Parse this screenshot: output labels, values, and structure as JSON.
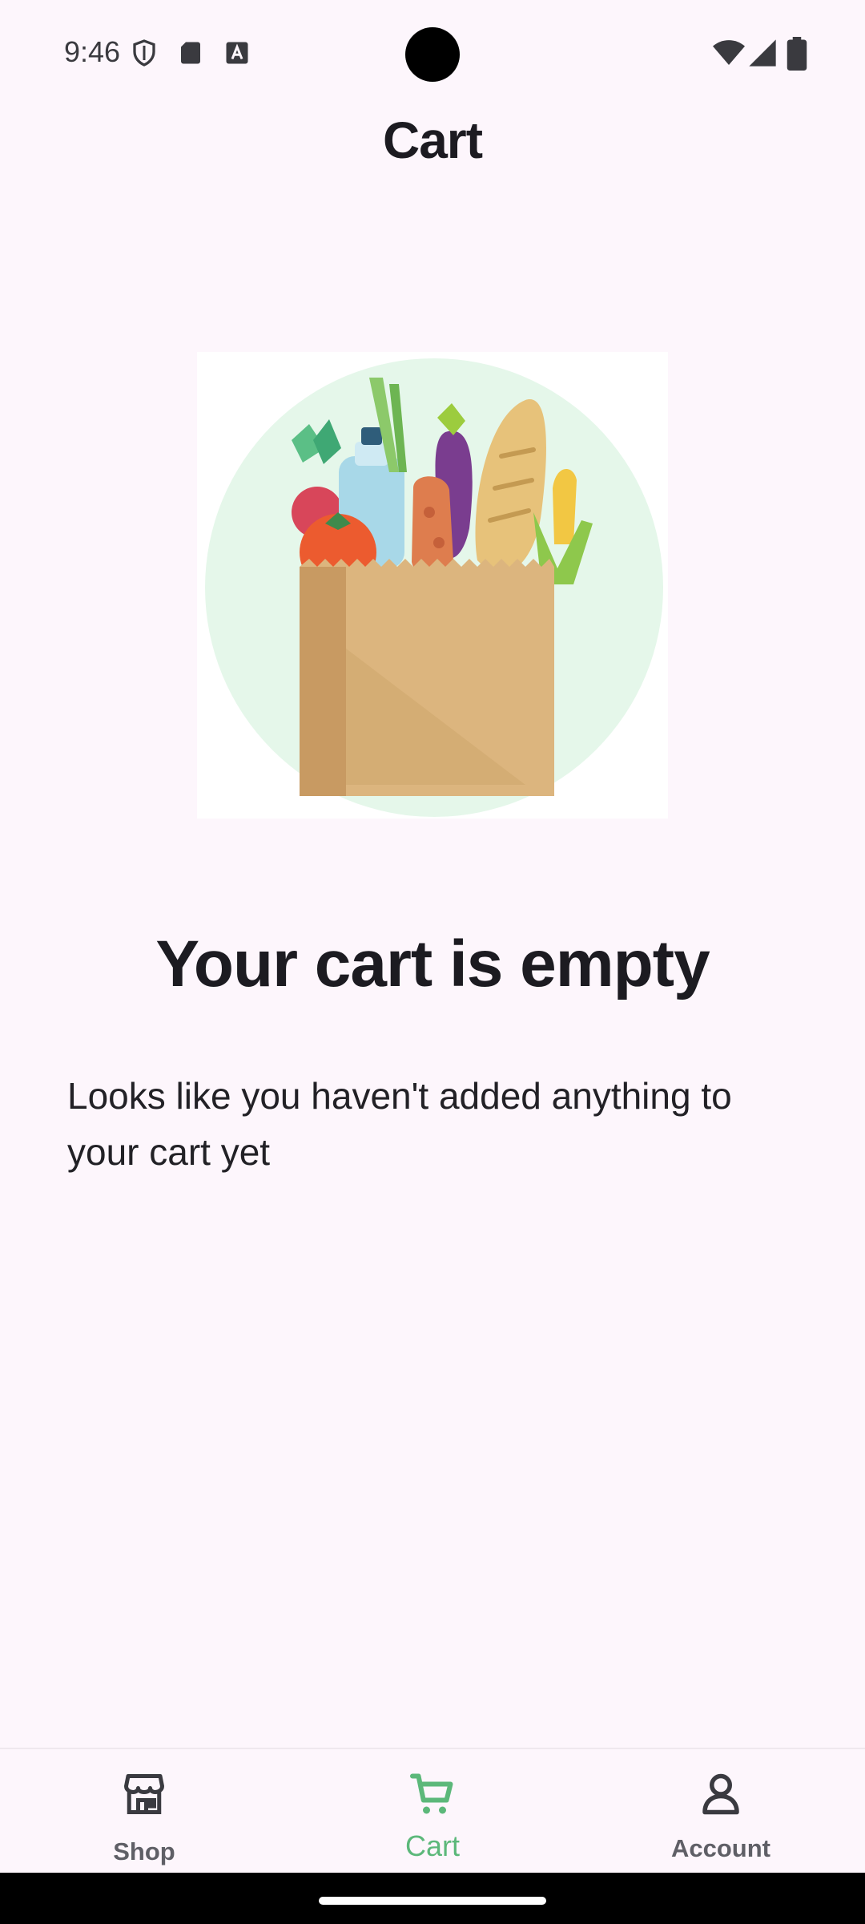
{
  "status_bar": {
    "time": "9:46",
    "icons_left": [
      "shield-icon",
      "sd-card-icon",
      "font-a-icon"
    ],
    "icons_right": [
      "wifi-icon",
      "signal-icon",
      "battery-icon"
    ]
  },
  "header": {
    "title": "Cart"
  },
  "illustration": {
    "name": "grocery-bag-illustration"
  },
  "empty_state": {
    "title": "Your cart is empty",
    "message": "Looks like you haven't added anything to your cart yet"
  },
  "bottom_nav": {
    "items": [
      {
        "label": "Shop",
        "icon": "store-icon",
        "active": false
      },
      {
        "label": "Cart",
        "icon": "cart-icon",
        "active": true
      },
      {
        "label": "Account",
        "icon": "person-icon",
        "active": false
      }
    ],
    "active_color": "#5cb87a",
    "inactive_color": "#5f5f66"
  },
  "colors": {
    "background": "#fdf6fc",
    "accent": "#5cb87a",
    "text": "#1c1b21"
  }
}
